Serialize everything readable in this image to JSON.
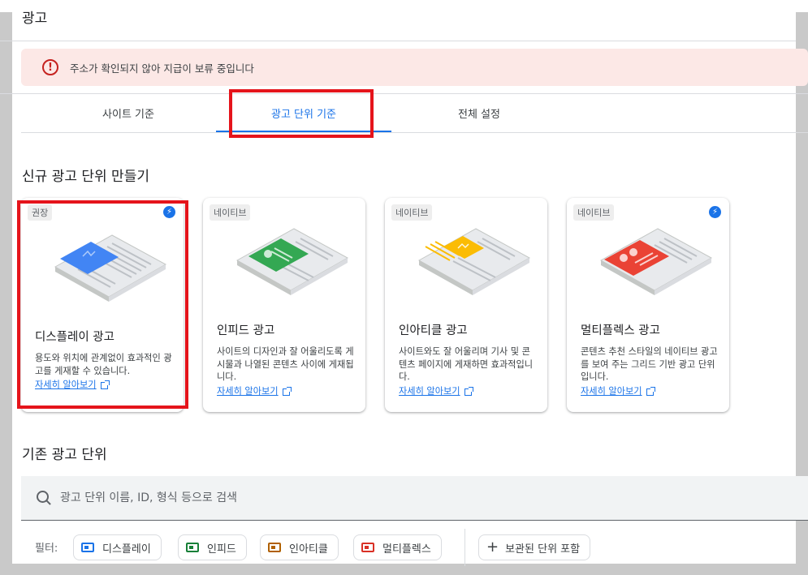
{
  "page": {
    "title": "광고"
  },
  "alert": {
    "text": "주소가 확인되지 않아 지급이 보류 중입니다",
    "icon": "error-icon",
    "color": "#c5221f"
  },
  "tabs": [
    {
      "label": "사이트 기준",
      "active": false
    },
    {
      "label": "광고 단위 기준",
      "active": true
    },
    {
      "label": "전체 설정",
      "active": false
    }
  ],
  "new_section": {
    "title": "신규 광고 단위 만들기"
  },
  "cards": [
    {
      "badge": "권장",
      "has_bolt": true,
      "title": "디스플레이 광고",
      "desc": "용도와 위치에 관계없이 효과적인 광고를 게재할 수 있습니다.",
      "link": "자세히 알아보기",
      "accent": "#4285f4"
    },
    {
      "badge": "네이티브",
      "has_bolt": false,
      "title": "인피드 광고",
      "desc": "사이트의 디자인과 잘 어울리도록 게시물과 나열된 콘텐츠 사이에 게재됩니다.",
      "link": "자세히 알아보기",
      "accent": "#34a853"
    },
    {
      "badge": "네이티브",
      "has_bolt": false,
      "title": "인아티클 광고",
      "desc": "사이트와도 잘 어울리며 기사 및 콘텐츠 페이지에 게재하면 효과적입니다.",
      "link": "자세히 알아보기",
      "accent": "#fbbc04"
    },
    {
      "badge": "네이티브",
      "has_bolt": true,
      "title": "멀티플렉스 광고",
      "desc": "콘텐츠 추천 스타일의 네이티브 광고를 보여 주는 그리드 기반 광고 단위입니다.",
      "link": "자세히 알아보기",
      "accent": "#ea4335"
    }
  ],
  "existing_section": {
    "title": "기존 광고 단위"
  },
  "search": {
    "placeholder": "광고 단위 이름, ID, 형식 등으로 검색"
  },
  "filters": {
    "label": "필터:",
    "chips": [
      "디스플레이",
      "인피드",
      "인아티클",
      "멀티플렉스"
    ],
    "archived": "보관된 단위 포함"
  },
  "highlight_color": "#e5141b",
  "accent": "#1a73e8"
}
